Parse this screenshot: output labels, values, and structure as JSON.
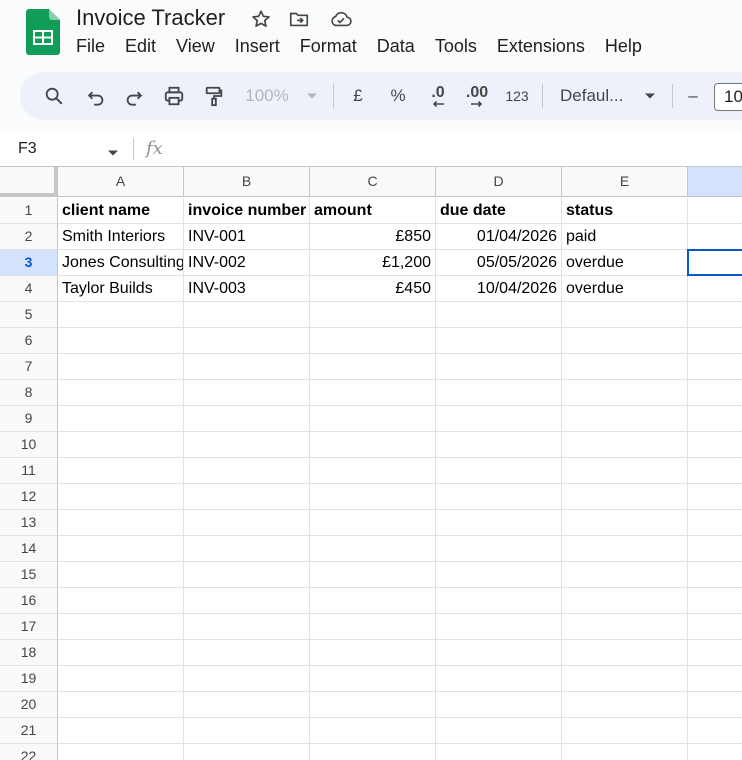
{
  "app": {
    "title": "Invoice Tracker"
  },
  "menu": [
    "File",
    "Edit",
    "View",
    "Insert",
    "Format",
    "Data",
    "Tools",
    "Extensions",
    "Help"
  ],
  "toolbar": {
    "zoom": "100%",
    "currency": "£",
    "percent": "%",
    "decimal_decrease": ".0",
    "decimal_increase": ".00",
    "number_format": "123",
    "font": "Defaul...",
    "font_size_minus": "–",
    "font_size": "10"
  },
  "formula_bar": {
    "name_box": "F3",
    "fx": "fx",
    "value": ""
  },
  "columns": [
    "A",
    "B",
    "C",
    "D",
    "E"
  ],
  "rows": [
    "1",
    "2",
    "3",
    "4",
    "5",
    "6",
    "7",
    "8",
    "9",
    "10",
    "11",
    "12",
    "13",
    "14",
    "15",
    "16",
    "17",
    "18",
    "19",
    "20",
    "21",
    "22"
  ],
  "sheet": {
    "headers": [
      "client name",
      "invoice number",
      "amount",
      "due date",
      "status"
    ],
    "data": [
      [
        "Smith Interiors",
        "INV-001",
        "£850",
        "01/04/2026",
        "paid"
      ],
      [
        "Jones Consulting",
        "INV-002",
        "£1,200",
        "05/05/2026",
        "overdue"
      ],
      [
        "Taylor Builds",
        "INV-003",
        "£450",
        "10/04/2026",
        "overdue"
      ]
    ]
  },
  "selection": {
    "cell": "F3",
    "column": "F",
    "row": "3"
  },
  "colors": {
    "accent": "#0b57d0",
    "header_active": "#d3e3fd",
    "sheets_green": "#0f9d58"
  }
}
